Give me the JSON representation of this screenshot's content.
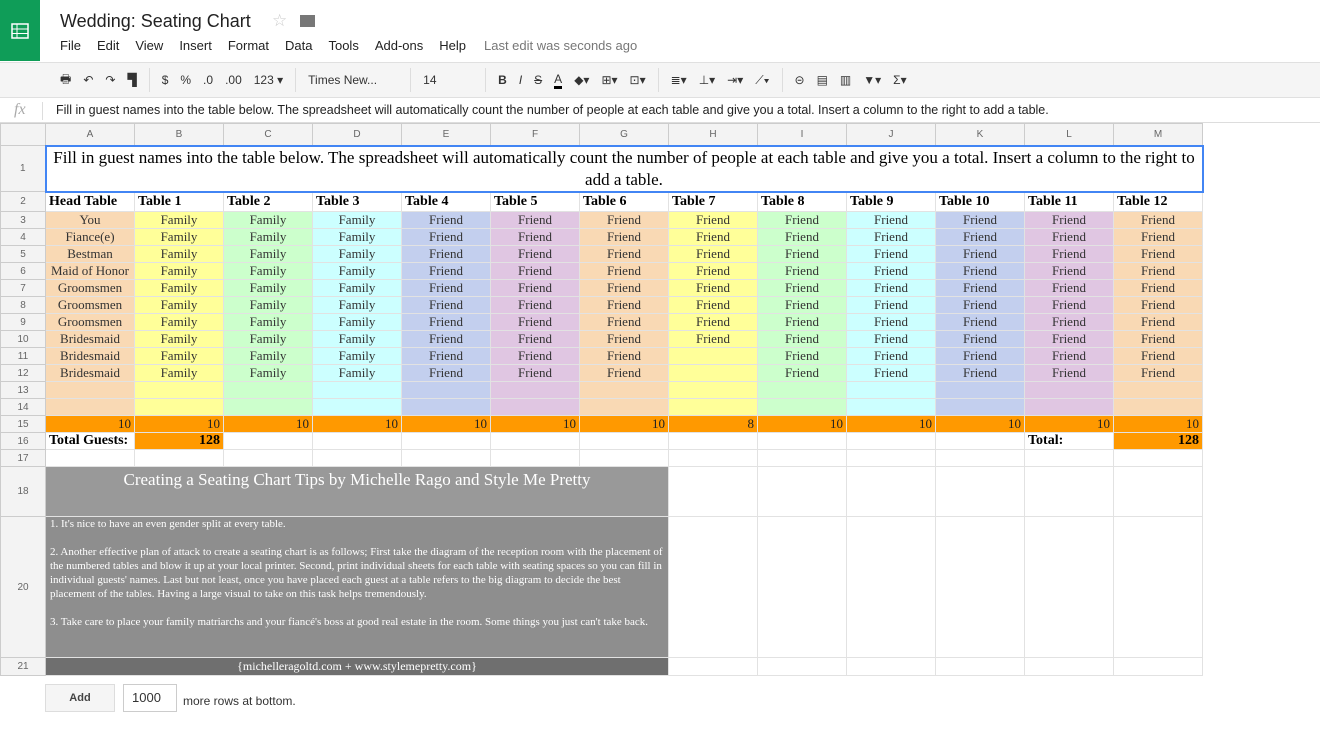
{
  "app": {
    "title": "Wedding: Seating Chart",
    "last_edit": "Last edit was seconds ago"
  },
  "menu": [
    "File",
    "Edit",
    "View",
    "Insert",
    "Format",
    "Data",
    "Tools",
    "Add-ons",
    "Help"
  ],
  "toolbar": {
    "currency": "$",
    "percent": "%",
    "dec_less": ".0",
    "dec_more": ".00",
    "format": "123 ▾",
    "font": "Times New...",
    "font_size": "14"
  },
  "formula": "Fill in guest names into the table below.  The spreadsheet will automatically count the number of people at each table and give you a total.  Insert a column to the right to add a table.",
  "columns": [
    "A",
    "B",
    "C",
    "D",
    "E",
    "F",
    "G",
    "H",
    "I",
    "J",
    "K",
    "L",
    "M"
  ],
  "rows": [
    "1",
    "2",
    "3",
    "4",
    "5",
    "6",
    "7",
    "8",
    "9",
    "10",
    "11",
    "12",
    "13",
    "14",
    "15",
    "16",
    "17",
    "18",
    "20",
    "21"
  ],
  "colors": [
    "#f9d9b4",
    "#ffff99",
    "#ccffcc",
    "#ccffff",
    "#c3cfee",
    "#e0c6e2",
    "#f9d9b4",
    "#ffff99",
    "#ccffcc",
    "#ccffff",
    "#c3cfee",
    "#e0c6e2",
    "#f9d9b4"
  ],
  "headers": [
    "Head Table",
    "Table 1",
    "Table 2",
    "Table 3",
    "Table 4",
    "Table 5",
    "Table 6",
    "Table 7",
    "Table 8",
    "Table 9",
    "Table 10",
    "Table 11",
    "Table 12"
  ],
  "guests": [
    [
      "You",
      "Fiance(e)",
      "Bestman",
      "Maid of Honor",
      "Groomsmen",
      "Groomsmen",
      "Groomsmen",
      "Bridesmaid",
      "Bridesmaid",
      "Bridesmaid"
    ],
    [
      "Family",
      "Family",
      "Family",
      "Family",
      "Family",
      "Family",
      "Family",
      "Family",
      "Family",
      "Family"
    ],
    [
      "Family",
      "Family",
      "Family",
      "Family",
      "Family",
      "Family",
      "Family",
      "Family",
      "Family",
      "Family"
    ],
    [
      "Family",
      "Family",
      "Family",
      "Family",
      "Family",
      "Family",
      "Family",
      "Family",
      "Family",
      "Family"
    ],
    [
      "Friend",
      "Friend",
      "Friend",
      "Friend",
      "Friend",
      "Friend",
      "Friend",
      "Friend",
      "Friend",
      "Friend"
    ],
    [
      "Friend",
      "Friend",
      "Friend",
      "Friend",
      "Friend",
      "Friend",
      "Friend",
      "Friend",
      "Friend",
      "Friend"
    ],
    [
      "Friend",
      "Friend",
      "Friend",
      "Friend",
      "Friend",
      "Friend",
      "Friend",
      "Friend",
      "Friend",
      "Friend"
    ],
    [
      "Friend",
      "Friend",
      "Friend",
      "Friend",
      "Friend",
      "Friend",
      "Friend",
      "Friend"
    ],
    [
      "Friend",
      "Friend",
      "Friend",
      "Friend",
      "Friend",
      "Friend",
      "Friend",
      "Friend",
      "Friend",
      "Friend"
    ],
    [
      "Friend",
      "Friend",
      "Friend",
      "Friend",
      "Friend",
      "Friend",
      "Friend",
      "Friend",
      "Friend",
      "Friend"
    ],
    [
      "Friend",
      "Friend",
      "Friend",
      "Friend",
      "Friend",
      "Friend",
      "Friend",
      "Friend",
      "Friend",
      "Friend"
    ],
    [
      "Friend",
      "Friend",
      "Friend",
      "Friend",
      "Friend",
      "Friend",
      "Friend",
      "Friend",
      "Friend",
      "Friend"
    ],
    [
      "Friend",
      "Friend",
      "Friend",
      "Friend",
      "Friend",
      "Friend",
      "Friend",
      "Friend",
      "Friend",
      "Friend"
    ]
  ],
  "counts": [
    "10",
    "10",
    "10",
    "10",
    "10",
    "10",
    "10",
    "8",
    "10",
    "10",
    "10",
    "10",
    "10"
  ],
  "total_label": "Total Guests:",
  "total_value": "128",
  "total_label2": "Total:",
  "total_value2": "128",
  "tips": {
    "title": "Creating a Seating Chart Tips by Michelle Rago and Style Me Pretty",
    "items": [
      "1. It's nice to have an even gender split at every table.",
      "2. Another effective plan of attack to create a seating chart is as follows; First take the diagram of the reception room with the placement of the numbered tables and blow it up at your local printer.  Second, print individual sheets for each table with seating spaces so you can fill in individual guests' names.  Last but not least, once you have placed each guest at a table refers to the big diagram to decide the best placement of the tables.   Having a large visual to take on this task helps tremendously.",
      "3. Take care to place your family matriarchs and your fiancé's boss at good real estate in the room. Some things you just can't take back."
    ],
    "footer": "{michelleragoltd.com + www.stylemepretty.com}"
  },
  "add_rows": {
    "button": "Add",
    "value": "1000",
    "suffix": "more rows at bottom."
  }
}
